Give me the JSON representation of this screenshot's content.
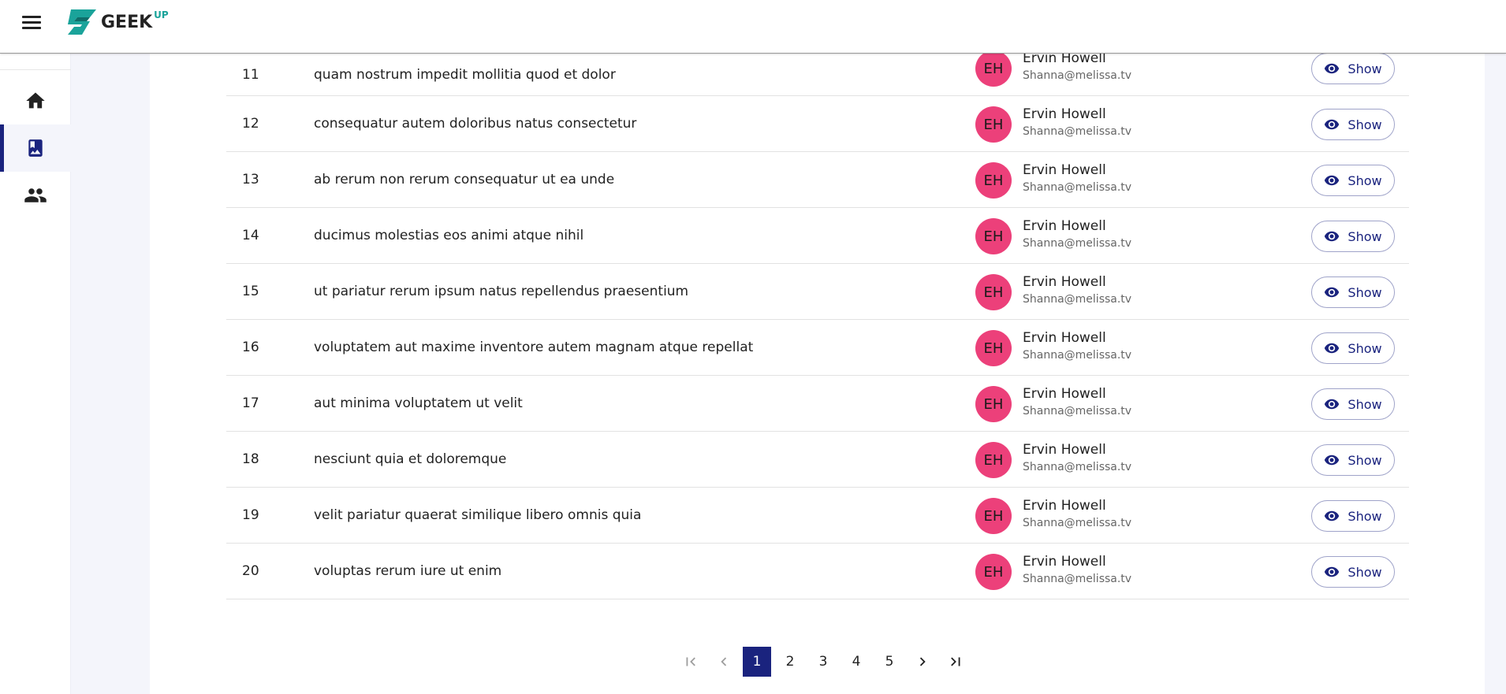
{
  "brand": {
    "name": "GEEK",
    "sup": "UP"
  },
  "colors": {
    "accent": "#1a237e",
    "avatar_bg": "#ec407a",
    "logo_green": "#1aa39a"
  },
  "sidebar": {
    "items": [
      {
        "icon": "home-icon",
        "active": false
      },
      {
        "icon": "photo-album-icon",
        "active": true
      },
      {
        "icon": "people-icon",
        "active": false
      }
    ]
  },
  "table": {
    "show_label": "Show",
    "rows": [
      {
        "id": "11",
        "title": "quam nostrum impedit mollitia quod et dolor",
        "initials": "EH",
        "user": "Ervin Howell",
        "email": "Shanna@melissa.tv"
      },
      {
        "id": "12",
        "title": "consequatur autem doloribus natus consectetur",
        "initials": "EH",
        "user": "Ervin Howell",
        "email": "Shanna@melissa.tv"
      },
      {
        "id": "13",
        "title": "ab rerum non rerum consequatur ut ea unde",
        "initials": "EH",
        "user": "Ervin Howell",
        "email": "Shanna@melissa.tv"
      },
      {
        "id": "14",
        "title": "ducimus molestias eos animi atque nihil",
        "initials": "EH",
        "user": "Ervin Howell",
        "email": "Shanna@melissa.tv"
      },
      {
        "id": "15",
        "title": "ut pariatur rerum ipsum natus repellendus praesentium",
        "initials": "EH",
        "user": "Ervin Howell",
        "email": "Shanna@melissa.tv"
      },
      {
        "id": "16",
        "title": "voluptatem aut maxime inventore autem magnam atque repellat",
        "initials": "EH",
        "user": "Ervin Howell",
        "email": "Shanna@melissa.tv"
      },
      {
        "id": "17",
        "title": "aut minima voluptatem ut velit",
        "initials": "EH",
        "user": "Ervin Howell",
        "email": "Shanna@melissa.tv"
      },
      {
        "id": "18",
        "title": "nesciunt quia et doloremque",
        "initials": "EH",
        "user": "Ervin Howell",
        "email": "Shanna@melissa.tv"
      },
      {
        "id": "19",
        "title": "velit pariatur quaerat similique libero omnis quia",
        "initials": "EH",
        "user": "Ervin Howell",
        "email": "Shanna@melissa.tv"
      },
      {
        "id": "20",
        "title": "voluptas rerum iure ut enim",
        "initials": "EH",
        "user": "Ervin Howell",
        "email": "Shanna@melissa.tv"
      }
    ]
  },
  "pagination": {
    "pages": [
      "1",
      "2",
      "3",
      "4",
      "5"
    ],
    "current": "1"
  }
}
